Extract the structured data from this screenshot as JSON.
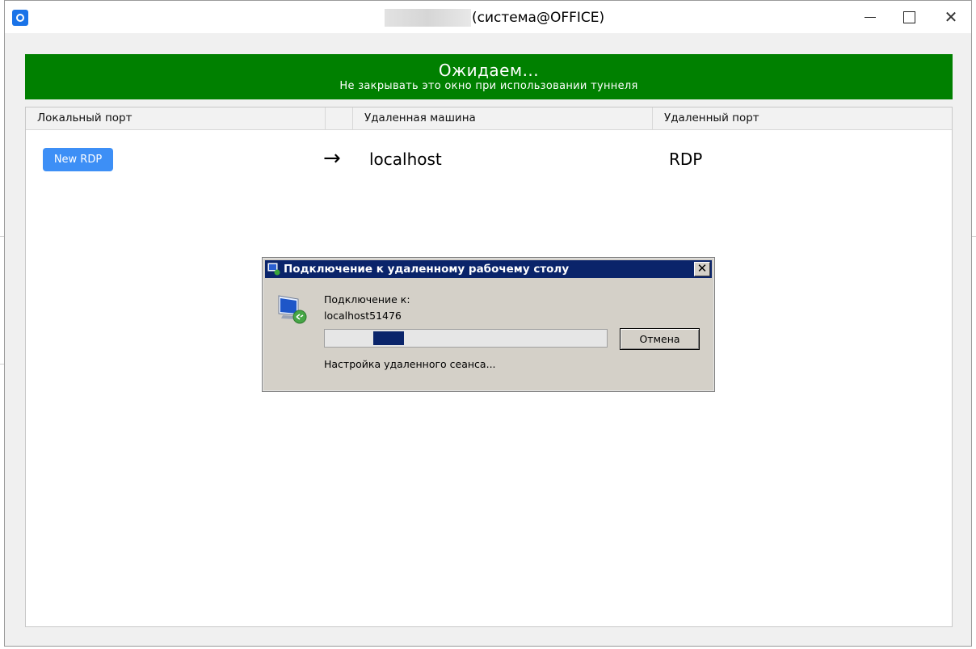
{
  "window": {
    "title": "(система@OFFICE)",
    "controls": {
      "minimize": "",
      "maximize": "",
      "close": "✕"
    }
  },
  "banner": {
    "title": "Ожидаем...",
    "subtitle": "Не закрывать это окно при использовании туннеля",
    "color": "#008000"
  },
  "table": {
    "columns": [
      "Локальный порт",
      "",
      "Удаленная машина",
      "Удаленный порт"
    ],
    "rows": [
      {
        "local_button": "New RDP",
        "arrow": "→",
        "remote_host": "localhost",
        "remote_port": "RDP"
      }
    ]
  },
  "dialog": {
    "title": "Подключение к удаленному рабочему столу",
    "close": "✕",
    "label": "Подключение к:",
    "host": "localhost51476",
    "progress": 0.15,
    "cancel_label": "Отмена",
    "status": "Настройка удаленного сеанса..."
  },
  "colors": {
    "accent_button": "#3d8ff6",
    "dialog_title": "#0a246a",
    "dialog_bg": "#d4d0c8"
  }
}
